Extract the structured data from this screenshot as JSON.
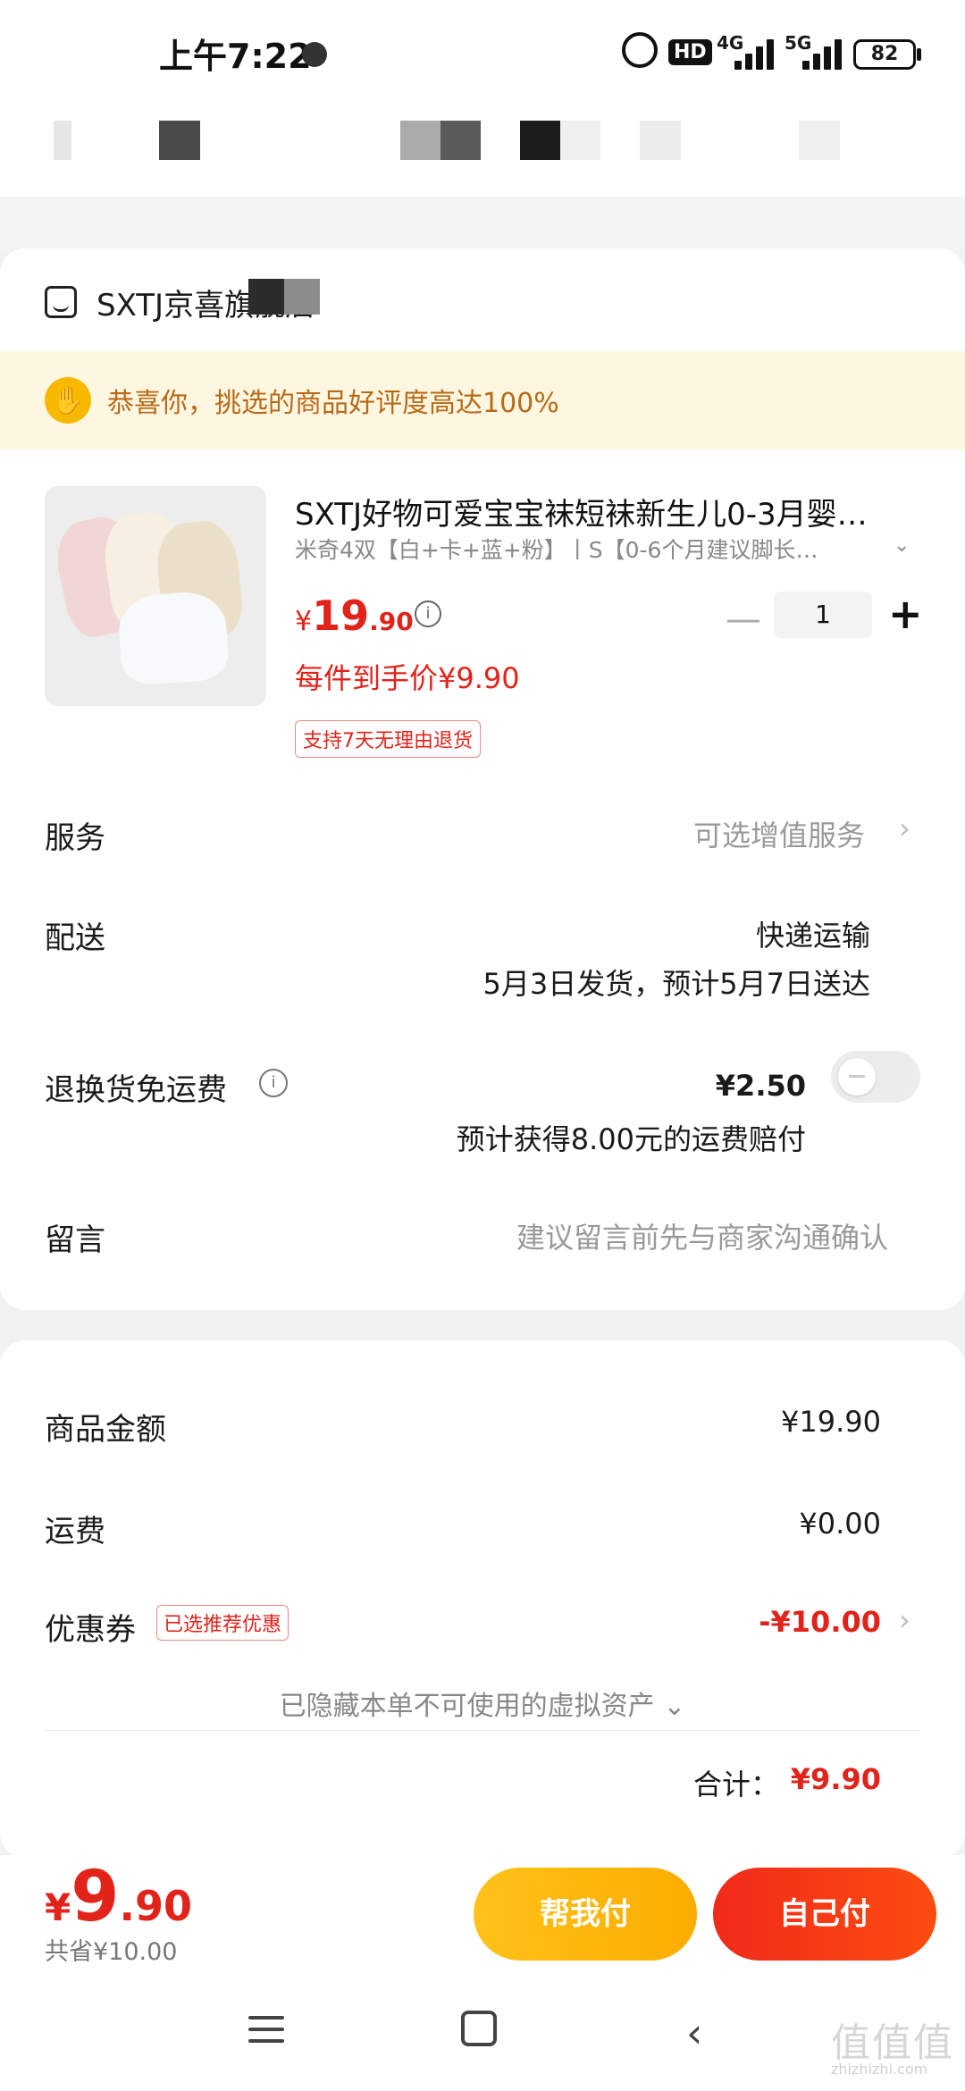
{
  "status_bar": {
    "time": "上午7:22",
    "network_1": "4G",
    "network_2": "5G",
    "hd_label": "HD",
    "battery": "82"
  },
  "store": {
    "name": "SXTJ京喜旗舰店"
  },
  "promo": {
    "text": "恭喜你，挑选的商品好评度高达100%"
  },
  "product": {
    "title": "SXTJ好物可爱宝宝袜短袜新生儿0-3月婴…",
    "spec": "米奇4双【白+卡+蓝+粉】丨S【0-6个月建议脚长…",
    "price_symbol": "¥",
    "price_int": "19",
    "price_dec": ".90",
    "quantity": "1",
    "net_price": "每件到手价¥9.90",
    "return_badge": "支持7天无理由退货"
  },
  "service": {
    "label": "服务",
    "value": "可选增值服务"
  },
  "delivery": {
    "label": "配送",
    "method": "快递运输",
    "schedule": "5月3日发货，预计5月7日送达"
  },
  "return_shipping": {
    "label": "退换货免运费",
    "price": "¥2.50",
    "note": "预计获得8.00元的运费赔付",
    "enabled": false
  },
  "message": {
    "label": "留言",
    "placeholder": "建议留言前先与商家沟通确认"
  },
  "summary": {
    "goods_label": "商品金额",
    "goods_value": "¥19.90",
    "shipping_label": "运费",
    "shipping_value": "¥0.00",
    "coupon_label": "优惠券",
    "coupon_tag": "已选推荐优惠",
    "coupon_value": "-¥10.00",
    "hidden_assets": "已隐藏本单不可使用的虚拟资产",
    "total_label": "合计：",
    "total_value": "¥9.90"
  },
  "bottom": {
    "price_symbol": "¥",
    "price_int": "9",
    "price_dec": ".90",
    "saved": "共省¥10.00",
    "help_pay": "帮我付",
    "self_pay": "自己付"
  },
  "watermark": {
    "logo": "值值值",
    "url": "zhizhizhi.com"
  },
  "colors": {
    "price_red": "#e2231a",
    "promo_bg": "#fdf6e1",
    "promo_text": "#b86a17",
    "help_btn": "#ffc21a",
    "self_btn": "#f12a1b"
  }
}
